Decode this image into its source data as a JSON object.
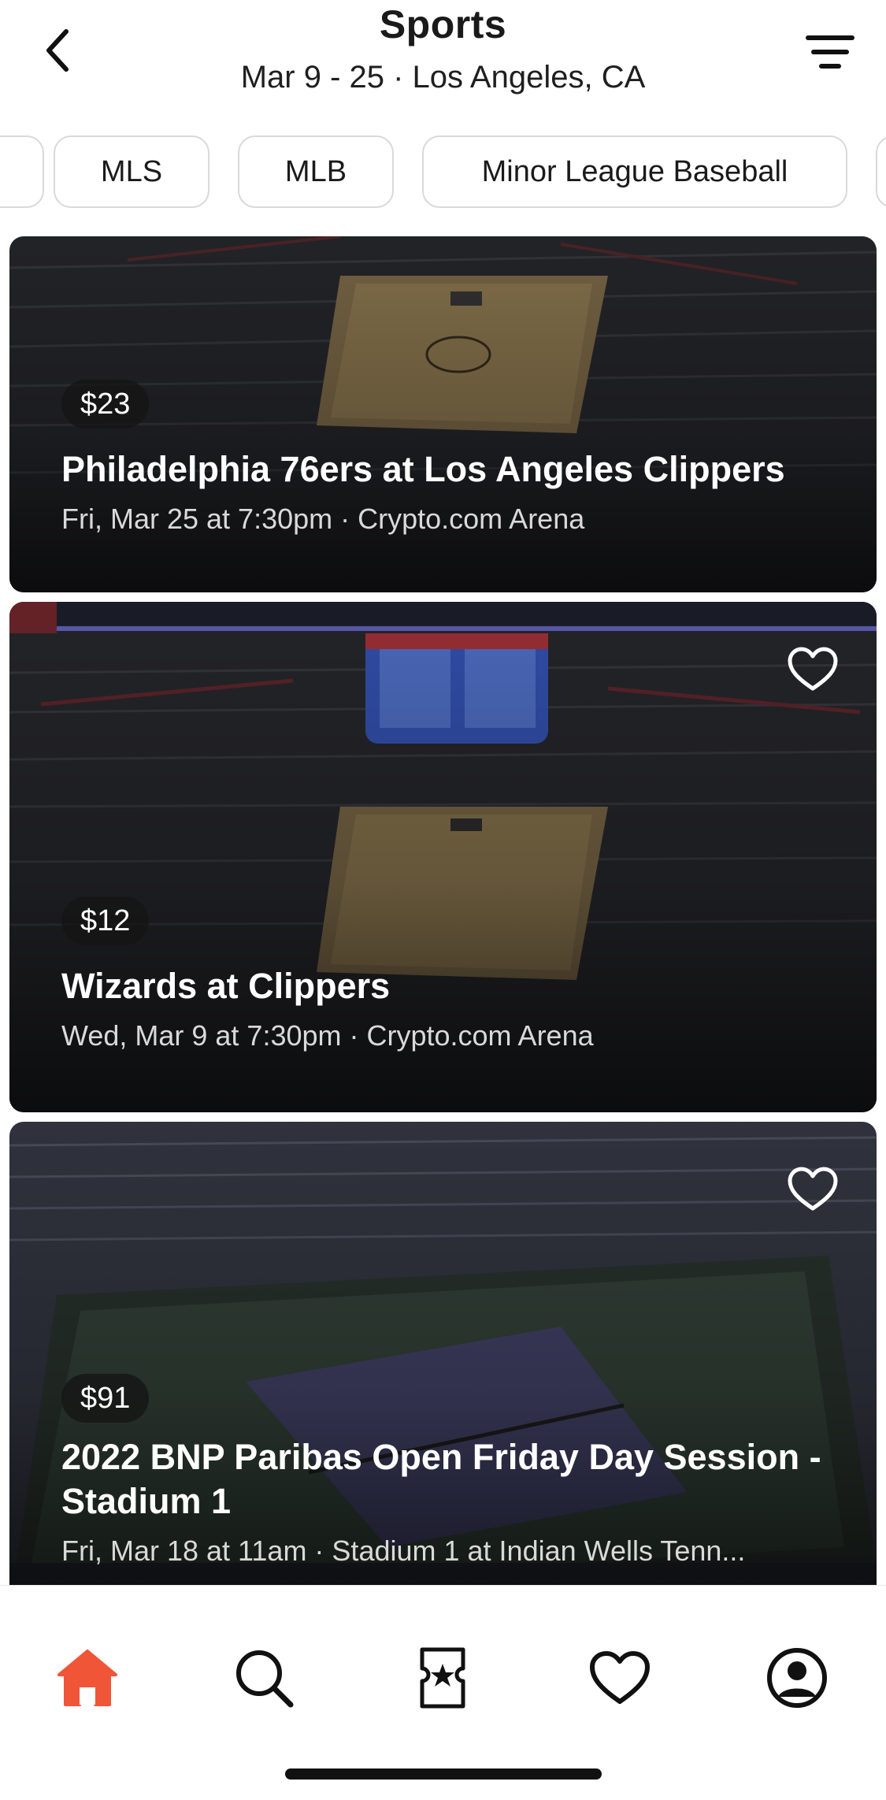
{
  "header": {
    "title": "Sports",
    "subtitle": "Mar 9 - 25 · Los Angeles, CA",
    "back_icon": "chevron-left-icon",
    "filter_icon": "filter-lines-icon"
  },
  "chips": [
    {
      "label": ""
    },
    {
      "label": "MLS"
    },
    {
      "label": "MLB"
    },
    {
      "label": "Minor League Baseball"
    },
    {
      "label": ""
    }
  ],
  "events": [
    {
      "price": "$23",
      "title": "Philadelphia 76ers at Los Angeles Clippers",
      "subtitle": "Fri, Mar 25 at 7:30pm · Crypto.com Arena",
      "favorite": false
    },
    {
      "price": "$12",
      "title": "Wizards at Clippers",
      "subtitle": "Wed, Mar 9 at 7:30pm · Crypto.com Arena",
      "favorite": false
    },
    {
      "price": "$91",
      "title": "2022 BNP Paribas Open Friday Day Session - Stadium 1",
      "subtitle": "Fri, Mar 18 at 11am · Stadium 1 at Indian Wells Tenn...",
      "favorite": false
    }
  ],
  "tabbar": {
    "active": "home",
    "accent_color": "#f05537",
    "tabs": [
      "home-icon",
      "search-icon",
      "ticket-icon",
      "heart-icon",
      "profile-icon"
    ]
  }
}
